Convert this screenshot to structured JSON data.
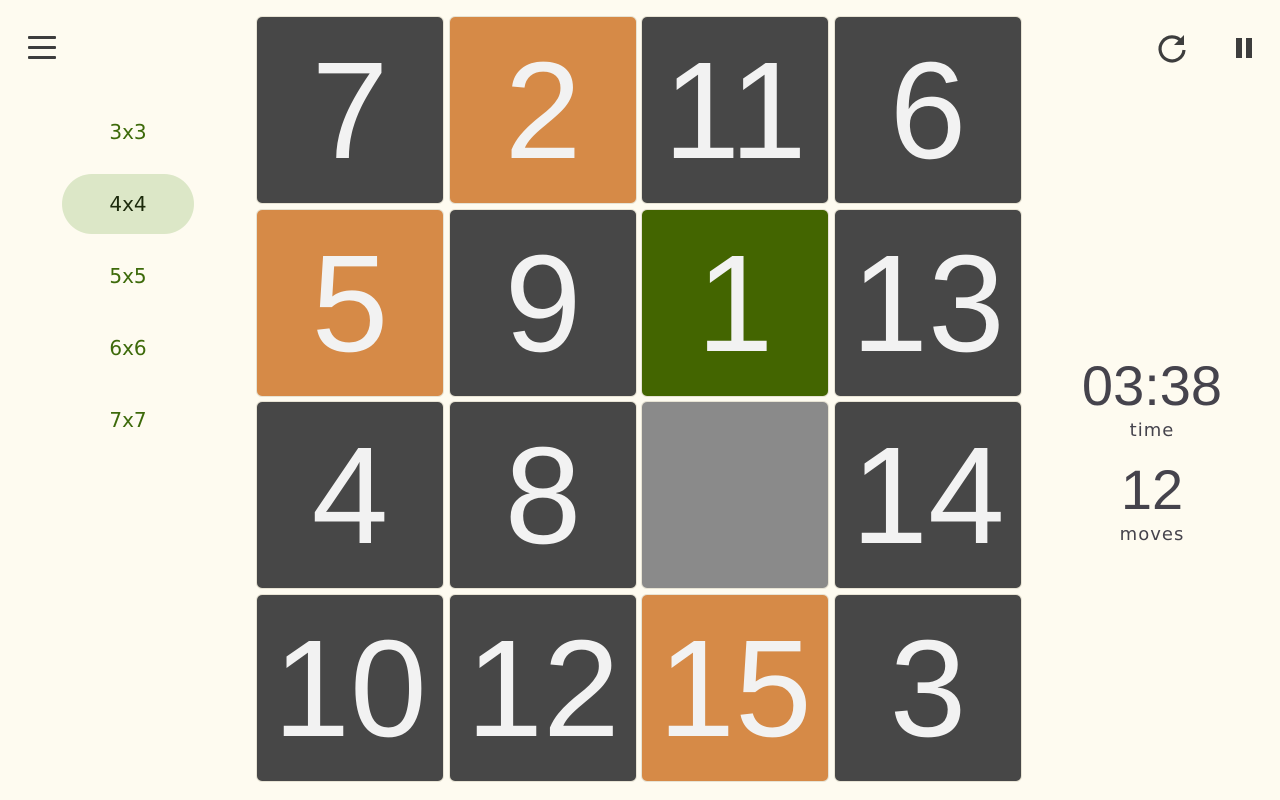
{
  "sidebar": {
    "sizes": [
      {
        "label": "3x3",
        "selected": false
      },
      {
        "label": "4x4",
        "selected": true
      },
      {
        "label": "5x5",
        "selected": false
      },
      {
        "label": "6x6",
        "selected": false
      },
      {
        "label": "7x7",
        "selected": false
      }
    ]
  },
  "board": {
    "size": 4,
    "tiles": [
      {
        "label": "7",
        "style": "dark"
      },
      {
        "label": "2",
        "style": "orange"
      },
      {
        "label": "11",
        "style": "dark"
      },
      {
        "label": "6",
        "style": "dark"
      },
      {
        "label": "5",
        "style": "orange"
      },
      {
        "label": "9",
        "style": "dark"
      },
      {
        "label": "1",
        "style": "green"
      },
      {
        "label": "13",
        "style": "dark"
      },
      {
        "label": "4",
        "style": "dark"
      },
      {
        "label": "8",
        "style": "dark"
      },
      {
        "label": "",
        "style": "empty"
      },
      {
        "label": "14",
        "style": "dark"
      },
      {
        "label": "10",
        "style": "dark"
      },
      {
        "label": "12",
        "style": "dark"
      },
      {
        "label": "15",
        "style": "orange"
      },
      {
        "label": "3",
        "style": "dark"
      }
    ]
  },
  "stats": {
    "time_value": "03:38",
    "time_label": "time",
    "moves_value": "12",
    "moves_label": "moves"
  },
  "toolbar": {
    "menu_icon": "hamburger-menu-icon",
    "restart_icon": "restart-icon",
    "pause_icon": "pause-icon"
  },
  "colors": {
    "background": "#fefbf0",
    "tile_dark": "#474747",
    "tile_orange": "#d68a47",
    "tile_green": "#436500",
    "tile_empty": "#8a8a8a",
    "size_selected_bg": "#dce7c7",
    "size_text": "#3d6a0a"
  }
}
